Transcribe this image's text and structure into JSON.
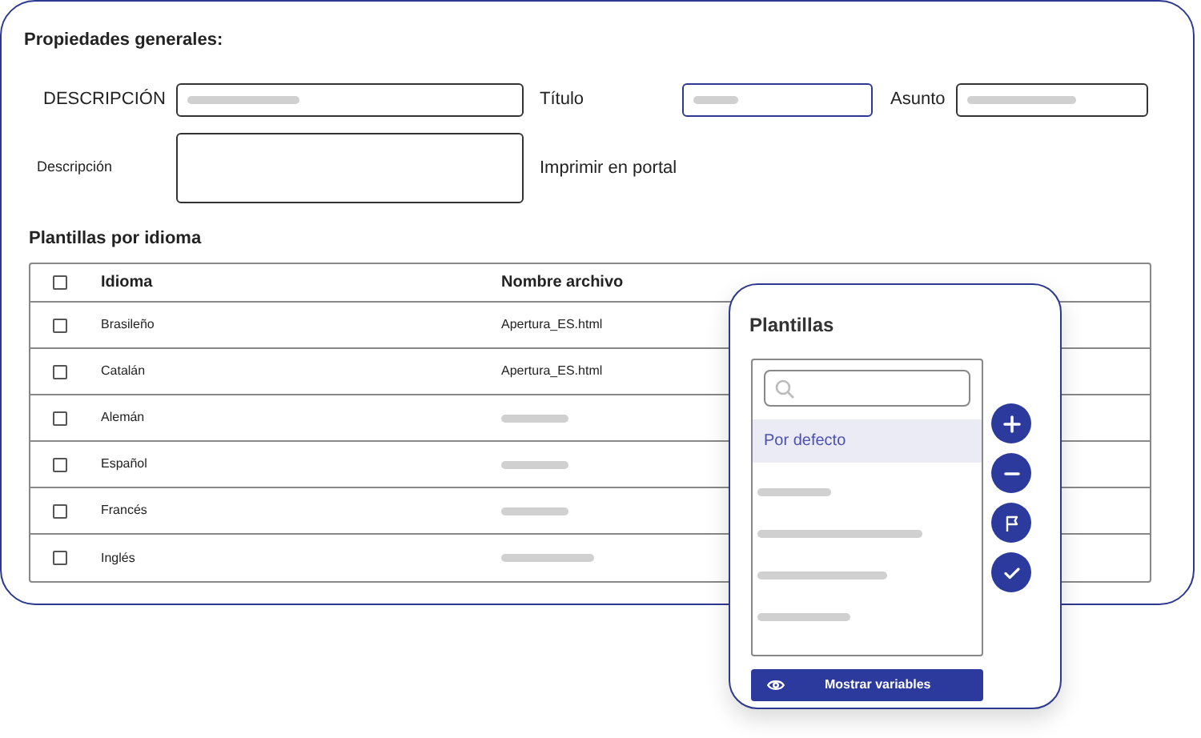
{
  "section_title": "Propiedades generales:",
  "fields": [
    {
      "label": "DESCRIPCIÓN",
      "focused": false
    },
    {
      "label": "Título",
      "focused": true
    },
    {
      "label": "Asunto",
      "focused": false
    }
  ],
  "description": {
    "label": "Descripción"
  },
  "print_label": "Imprimir en portal",
  "table": {
    "title": "Plantillas por idioma",
    "columns": [
      "Idioma",
      "Nombre archivo"
    ],
    "header_checked": false,
    "rows": [
      {
        "language": "Brasileño",
        "file": "Apertura_ES.html",
        "checked": false
      },
      {
        "language": "Catalán",
        "file": "Apertura_ES.html",
        "checked": false
      },
      {
        "language": "Alemán",
        "checked": false
      },
      {
        "language": "Español",
        "checked": false
      },
      {
        "language": "Francés",
        "checked": false
      },
      {
        "language": "Inglés",
        "checked": false
      }
    ]
  },
  "templates_panel": {
    "title": "Plantillas",
    "items": [
      {
        "kind": "text",
        "label": "Por defecto",
        "selected": true
      },
      {
        "kind": "skeleton",
        "selected": false
      },
      {
        "kind": "skeleton",
        "selected": false
      },
      {
        "kind": "skeleton",
        "selected": false
      },
      {
        "kind": "skeleton",
        "selected": false
      }
    ],
    "actions": [
      {
        "kind": "add"
      },
      {
        "kind": "remove"
      },
      {
        "kind": "flag"
      },
      {
        "kind": "confirm"
      }
    ],
    "show_variables_button": "Mostrar variables"
  }
}
